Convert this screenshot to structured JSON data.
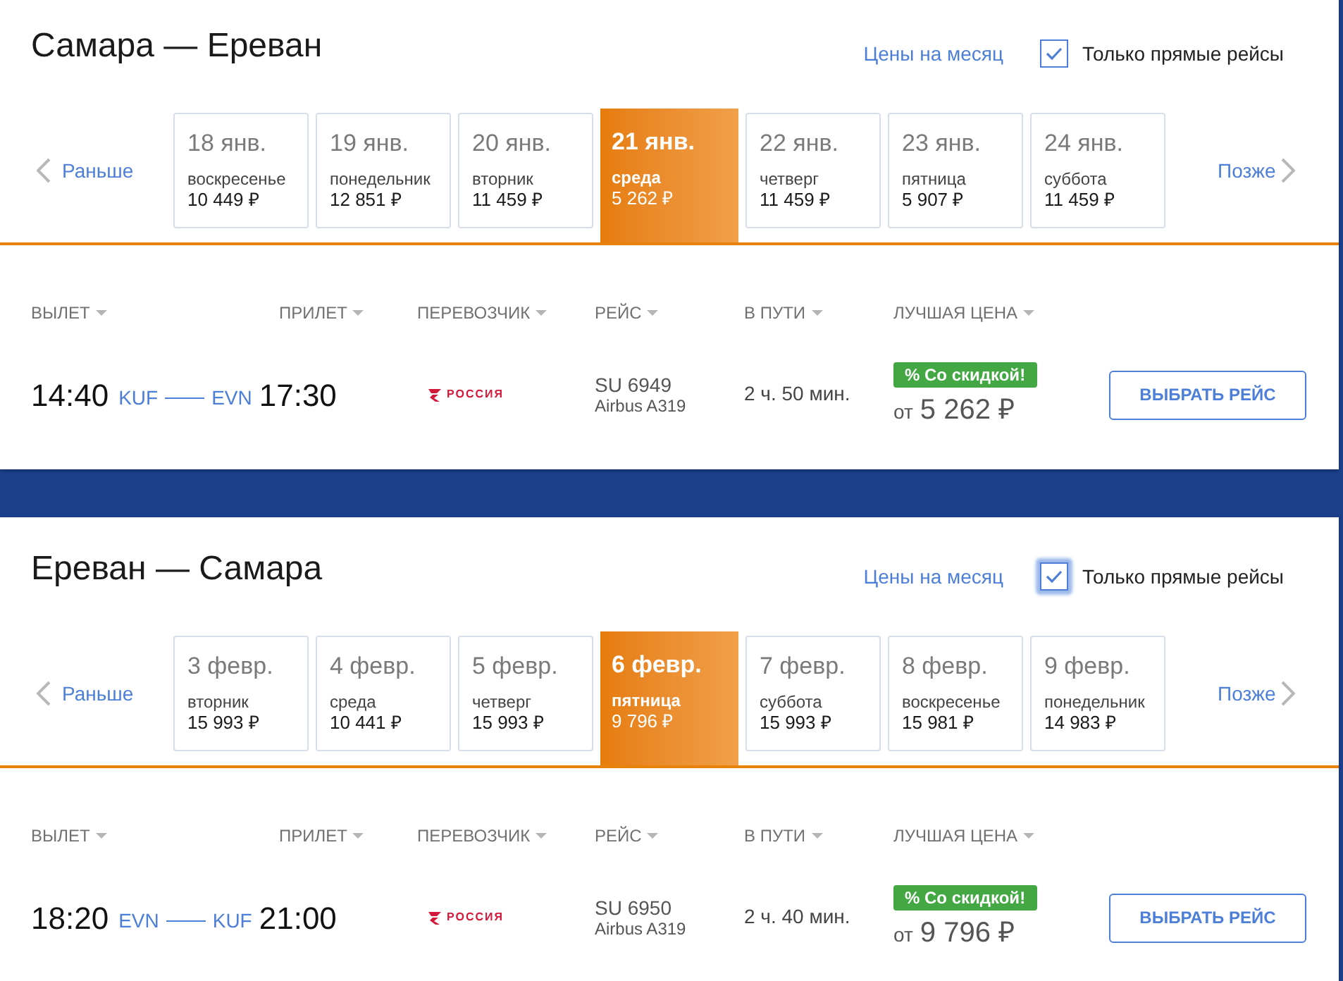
{
  "sections": [
    {
      "title": "Самара — Ереван",
      "month_prices_link": "Цены на месяц",
      "direct_only": {
        "label": "Только прямые рейсы",
        "checked": true,
        "focused": false
      },
      "earlier": "Раньше",
      "later": "Позже",
      "dates": [
        {
          "date": "18 янв.",
          "weekday": "воскресенье",
          "price": "10 449 ₽",
          "selected": false
        },
        {
          "date": "19 янв.",
          "weekday": "понедельник",
          "price": "12 851 ₽",
          "selected": false
        },
        {
          "date": "20 янв.",
          "weekday": "вторник",
          "price": "11 459 ₽",
          "selected": false
        },
        {
          "date": "21 янв.",
          "weekday": "среда",
          "price": "5 262 ₽",
          "selected": true
        },
        {
          "date": "22 янв.",
          "weekday": "четверг",
          "price": "11 459 ₽",
          "selected": false
        },
        {
          "date": "23 янв.",
          "weekday": "пятница",
          "price": "5 907 ₽",
          "selected": false
        },
        {
          "date": "24 янв.",
          "weekday": "суббота",
          "price": "11 459 ₽",
          "selected": false
        }
      ],
      "columns": [
        "ВЫЛЕТ",
        "ПРИЛЕТ",
        "ПЕРЕВОЗЧИК",
        "РЕЙС",
        "В ПУТИ",
        "ЛУЧШАЯ ЦЕНА"
      ],
      "flights": [
        {
          "departure_time": "14:40",
          "from": "KUF",
          "to": "EVN",
          "arrival_time": "17:30",
          "carrier": "РОССИЯ",
          "flight_number": "SU 6949",
          "aircraft": "Airbus A319",
          "duration": "2 ч. 50 мин.",
          "badge": "% Со скидкой!",
          "price_prefix": "от",
          "price": "5 262 ₽",
          "button": "ВЫБРАТЬ РЕЙС"
        }
      ]
    },
    {
      "title": "Ереван — Самара",
      "month_prices_link": "Цены на месяц",
      "direct_only": {
        "label": "Только прямые рейсы",
        "checked": true,
        "focused": true
      },
      "earlier": "Раньше",
      "later": "Позже",
      "dates": [
        {
          "date": "3 февр.",
          "weekday": "вторник",
          "price": "15 993 ₽",
          "selected": false
        },
        {
          "date": "4 февр.",
          "weekday": "среда",
          "price": "10 441 ₽",
          "selected": false
        },
        {
          "date": "5 февр.",
          "weekday": "четверг",
          "price": "15 993 ₽",
          "selected": false
        },
        {
          "date": "6 февр.",
          "weekday": "пятница",
          "price": "9 796 ₽",
          "selected": true
        },
        {
          "date": "7 февр.",
          "weekday": "суббота",
          "price": "15 993 ₽",
          "selected": false
        },
        {
          "date": "8 февр.",
          "weekday": "воскресенье",
          "price": "15 981 ₽",
          "selected": false
        },
        {
          "date": "9 февр.",
          "weekday": "понедельник",
          "price": "14 983 ₽",
          "selected": false
        }
      ],
      "columns": [
        "ВЫЛЕТ",
        "ПРИЛЕТ",
        "ПЕРЕВОЗЧИК",
        "РЕЙС",
        "В ПУТИ",
        "ЛУЧШАЯ ЦЕНА"
      ],
      "flights": [
        {
          "departure_time": "18:20",
          "from": "EVN",
          "to": "KUF",
          "arrival_time": "21:00",
          "carrier": "РОССИЯ",
          "flight_number": "SU 6950",
          "aircraft": "Airbus A319",
          "duration": "2 ч. 40 мин.",
          "badge": "% Со скидкой!",
          "price_prefix": "от",
          "price": "9 796 ₽",
          "button": "ВЫБРАТЬ РЕЙС"
        }
      ]
    }
  ]
}
